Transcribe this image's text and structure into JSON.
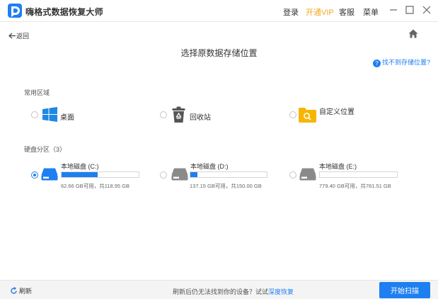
{
  "app": {
    "title": "嗨格式数据恢复大师",
    "accent": "#1e7ff0",
    "vip_color": "#f5a623"
  },
  "titlebar": {
    "menu": [
      {
        "label": "登录"
      },
      {
        "label": "开通VIP"
      },
      {
        "label": "客服"
      },
      {
        "label": "菜单"
      }
    ]
  },
  "nav": {
    "back_label": "返回"
  },
  "page_title": "选择原数据存储位置",
  "help": {
    "label": "找不到存储位置?"
  },
  "common": {
    "label": "常用区域",
    "items": [
      {
        "label": "桌面",
        "icon": "windows-icon",
        "selected": false
      },
      {
        "label": "回收站",
        "icon": "recycle-bin-icon",
        "selected": false
      },
      {
        "label": "自定义位置",
        "icon": "folder-search-icon",
        "selected": false
      }
    ]
  },
  "partitions": {
    "label": "硬盘分区（3）",
    "items": [
      {
        "name": "本地磁盘 (C:)",
        "capacity": "62.66 GB可用，共118.95 GB",
        "used_fraction": 0.47,
        "selected": true,
        "icon": "hard-disk-icon"
      },
      {
        "name": "本地磁盘 (D:)",
        "capacity": "137.15 GB可用，共150.00 GB",
        "used_fraction": 0.09,
        "selected": false,
        "icon": "hard-disk-icon"
      },
      {
        "name": "本地磁盘 (E:)",
        "capacity": "779.40 GB可用，共781.51 GB",
        "used_fraction": 0.0,
        "selected": false,
        "icon": "hard-disk-icon"
      }
    ]
  },
  "footer": {
    "refresh_label": "刷新",
    "message": "刷新后仍无法找到你的设备？试试",
    "deep_link": "深度恢复",
    "scan_button": "开始扫描"
  }
}
